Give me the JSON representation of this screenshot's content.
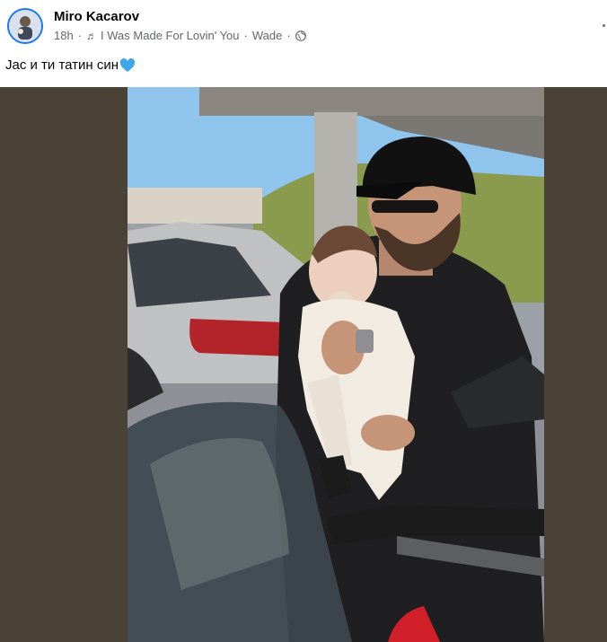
{
  "post": {
    "author": "Miro Kacarov",
    "time": "18h",
    "separator": "·",
    "music_icon": "music-note-icon",
    "song": "I Was Made For Lovin' You",
    "artist": "Wade",
    "audience_icon": "globe-icon",
    "caption_text": "Јас и ти татин син",
    "caption_emoji": "blue-heart-icon",
    "colors": {
      "name": "#050505",
      "meta": "#65676b",
      "avatar_ring": "#1877f2",
      "heart": "#3fa7e8",
      "media_bg": "#4a4237"
    }
  }
}
